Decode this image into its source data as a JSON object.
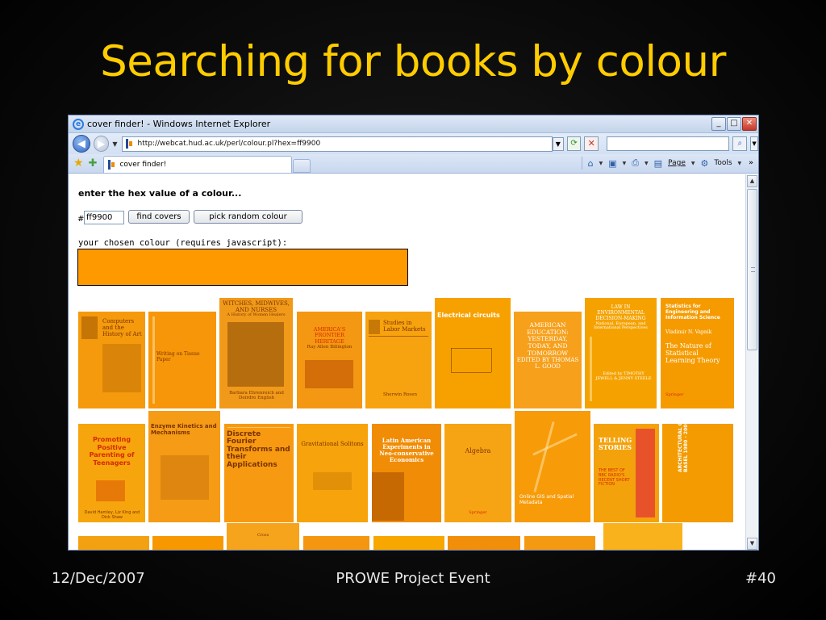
{
  "slide": {
    "title": "Searching for books by colour",
    "footer_left": "12/Dec/2007",
    "footer_center": "PROWE Project Event",
    "footer_right": "#40"
  },
  "browser": {
    "window_title": "cover finder! - Windows Internet Explorer",
    "url": "http://webcat.hud.ac.uk/perl/colour.pl?hex=ff9900",
    "tab_label": "cover finder!",
    "cmd_page": "Page",
    "cmd_tools": "Tools",
    "overflow": "»"
  },
  "page": {
    "prompt": "enter the hex value of a colour...",
    "hash": "#",
    "hex_value": "ff9900",
    "find_button": "find covers",
    "random_button": "pick random colour",
    "chosen_label": "your chosen colour (requires javascript):",
    "chosen_colour": "#ff9900"
  },
  "covers": {
    "r1": [
      {
        "title": "Computers and the History of Art"
      },
      {
        "title": "Writing on Tissue Paper"
      },
      {
        "title": "WITCHES, MIDWIVES, AND NURSES",
        "sub": "A History of Women Healers",
        "authors": "Barbara Ehrenreich and Deirdre English"
      },
      {
        "title": "AMERICA'S FRONTIER HERITAGE",
        "author": "Ray Allen Billington"
      },
      {
        "title": "Studies in Labor Markets",
        "author": "Sherwin Rosen"
      },
      {
        "title": "Electrical circuits"
      },
      {
        "title": "AMERICAN EDUCATION: YESTERDAY, TODAY, AND TOMORROW",
        "editor": "EDITED BY THOMAS L. GOOD"
      },
      {
        "title": "LAW IN ENVIRONMENTAL DECISION-MAKING",
        "sub": "National, European, and International Perspectives",
        "editors": "Edited by TIMOTHY JEWELL & JENNY STEELE"
      },
      {
        "title": "Statistics for Engineering and Information Science",
        "author": "Vladimir N. Vapnik",
        "sub": "The Nature of Statistical Learning Theory",
        "publisher": "Springer"
      }
    ],
    "r2": [
      {
        "title": "Promoting Positive Parenting of Teenagers",
        "authors": "David Hamley, Liz King and Dick Shaw"
      },
      {
        "title": "Enzyme Kinetics and Mechanisms"
      },
      {
        "title": "Discrete Fourier Transforms and their Applications"
      },
      {
        "title": "Gravitational Solitons"
      },
      {
        "title": "Latin American Experiments in Neo-conservative Economics"
      },
      {
        "title": "Algebra",
        "publisher": "Springer"
      },
      {
        "title": "Online GIS and Spatial Metadata"
      },
      {
        "title": "TELLING STORIES",
        "sub": "THE BEST OF BBC RADIO'S RECENT SHORT FICTION"
      },
      {
        "title": "ARCHITECTURAL GUIDE BASEL 1980 - 2000"
      }
    ],
    "r3": [
      {
        "title": "Cross"
      }
    ]
  }
}
